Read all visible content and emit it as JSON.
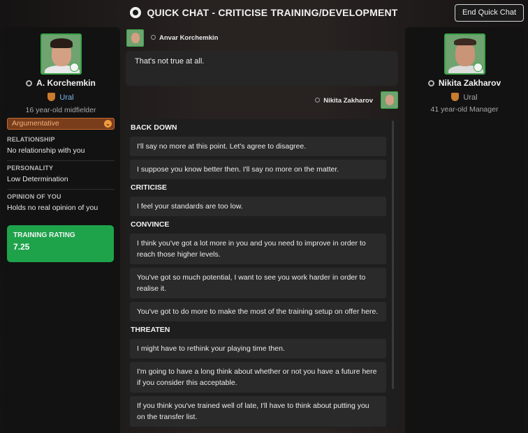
{
  "header": {
    "title": "QUICK CHAT - CRITICISE TRAINING/DEVELOPMENT",
    "end_button": "End Quick Chat"
  },
  "player": {
    "name": "A. Korchemkin",
    "club": "Ural",
    "description": "16 year-old midfielder",
    "trait": "Argumentative",
    "relationship_label": "RELATIONSHIP",
    "relationship_value": "No relationship with you",
    "personality_label": "PERSONALITY",
    "personality_value": "Low Determination",
    "opinion_label": "OPINION OF YOU",
    "opinion_value": "Holds no real opinion of you",
    "rating_label": "TRAINING RATING",
    "rating_value": "7.25"
  },
  "manager": {
    "name": "Nikita Zakharov",
    "club": "Ural",
    "description": "41 year-old Manager"
  },
  "chat": {
    "player_speaker": "Anvar Korchemkin",
    "player_message": "That's not true at all.",
    "manager_speaker": "Nikita Zakharov"
  },
  "options": {
    "cat_back_down": "BACK DOWN",
    "back_down_1": "I'll say no more at this point. Let's agree to disagree.",
    "back_down_2": "I suppose you know better then. I'll say no more on the matter.",
    "cat_criticise": "CRITICISE",
    "criticise_1": "I feel your standards are too low.",
    "cat_convince": "CONVINCE",
    "convince_1": "I think you've got a lot more in you and you need to improve in order to reach those higher levels.",
    "convince_2": "You've got so much potential, I want to see you work harder in order to realise it.",
    "convince_3": "You've got to do more to make the most of the training setup on offer here.",
    "cat_threaten": "THREATEN",
    "threaten_1": "I might have to rethink your playing time then.",
    "threaten_2": "I'm going to have a long think about whether or not you have a future here if you consider this acceptable.",
    "threaten_3": "If you think you've trained well of late, I'll have to think about putting you on the transfer list."
  },
  "colors": {
    "accent_green": "#1ea34a",
    "trait_orange": "#7a3d1c",
    "club_link": "#7ab8e8"
  }
}
